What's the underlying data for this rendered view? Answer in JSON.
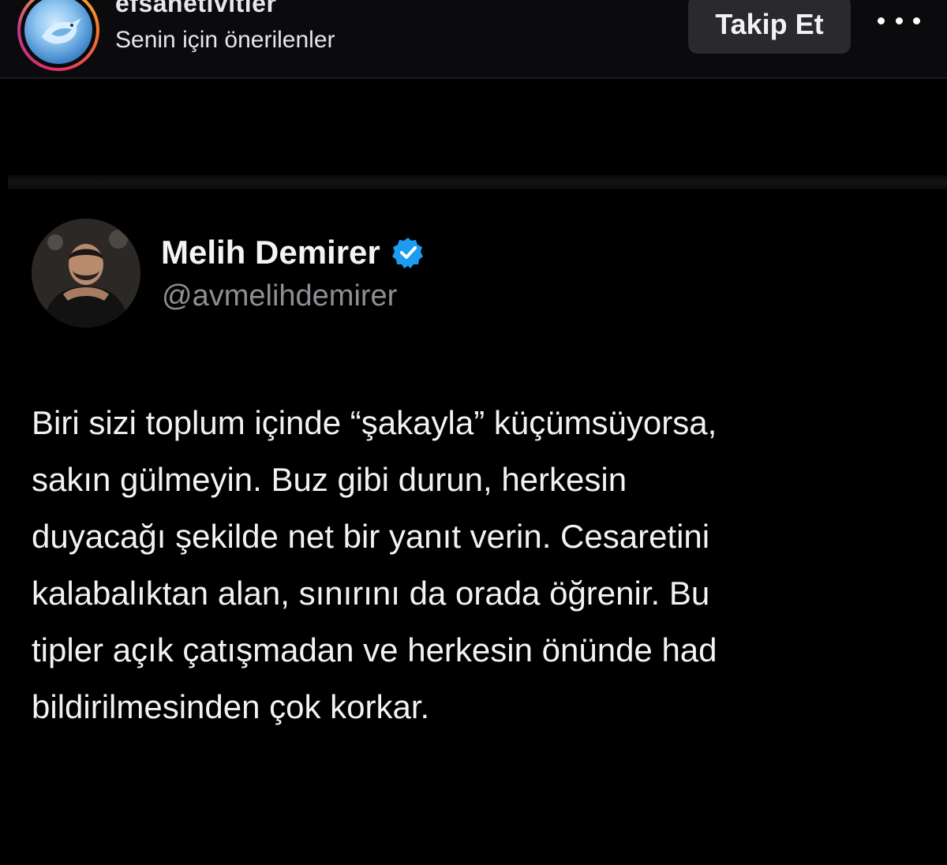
{
  "header": {
    "account_name": "efsanetivitler",
    "subtitle": "Senin için önerilenler",
    "follow_label": "Takip Et",
    "more_icon": "more-horizontal-icon",
    "story_ring_colors": [
      "#f9c23c",
      "#f27a2a",
      "#e1306c",
      "#c13584"
    ]
  },
  "tweet": {
    "display_name": "Melih Demirer",
    "verified_icon": "verified-badge-icon",
    "verified_color": "#1d9bf0",
    "handle": "@avmelihdemirer",
    "text": "Biri sizi toplum içinde “şakayla” küçümsüyorsa,\nsakın gülmeyin. Buz gibi durun, herkesin\nduyacağı şekilde net bir yanıt verin. Cesaretini\nkalabalıktan alan, sınırını da orada öğrenir. Bu\ntipler açık çatışmadan ve herkesin önünde had\nbildirilmesinden çok korkar."
  }
}
